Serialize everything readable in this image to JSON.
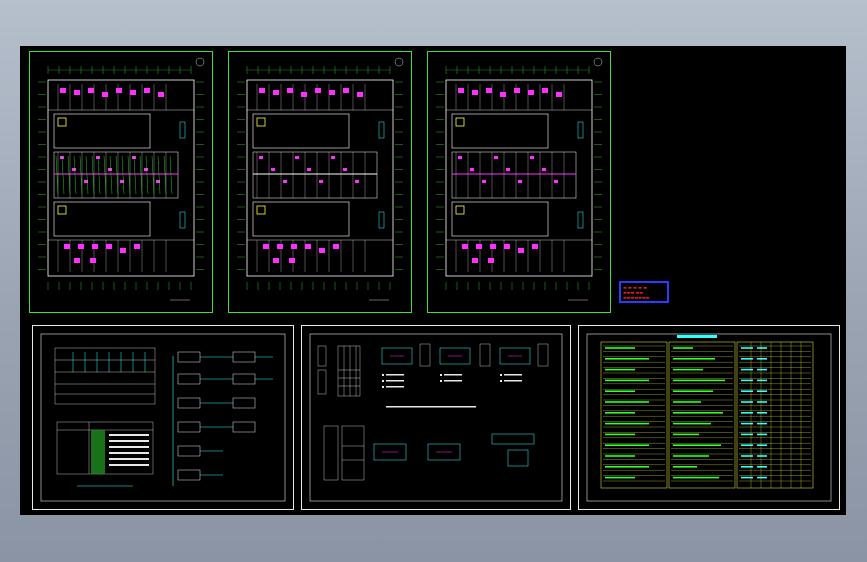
{
  "viewport": {
    "background": "#000000",
    "frame_color": "#3fe03f"
  },
  "sheets": [
    {
      "id": "floor-plan-1",
      "kind": "floor-plan",
      "color": "#3fe03f"
    },
    {
      "id": "floor-plan-2",
      "kind": "floor-plan",
      "color": "#3fe03f"
    },
    {
      "id": "floor-plan-3",
      "kind": "floor-plan",
      "color": "#3fe03f"
    },
    {
      "id": "system-diagram",
      "kind": "schematic",
      "color": "#e8e8e8"
    },
    {
      "id": "wiring-diagrams",
      "kind": "schematic",
      "color": "#e8e8e8"
    },
    {
      "id": "design-notes",
      "kind": "table",
      "color": "#e8e8e8"
    }
  ],
  "legend": {
    "border_color": "#2a3cff",
    "text_color": "#ff2020"
  },
  "colors": {
    "walls": "#ffffff",
    "rooms": "#ff30ff",
    "grid": "#3fe03f",
    "yellow": "#ffff40",
    "cyan": "#30ffff",
    "red": "#ff2020"
  }
}
